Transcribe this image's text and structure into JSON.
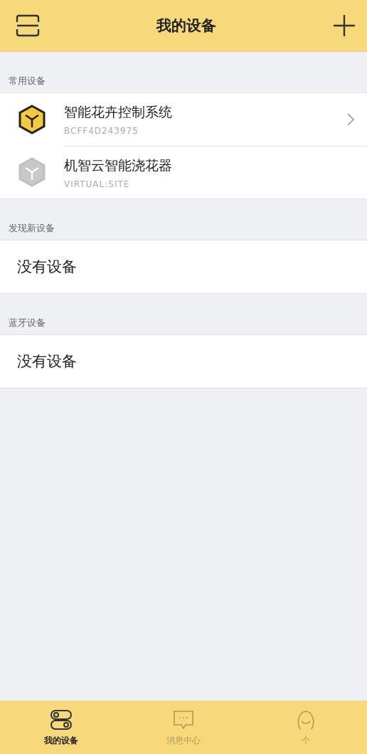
{
  "header": {
    "title": "我的设备"
  },
  "sections": [
    {
      "title": "常用设备",
      "devices": [
        {
          "name": "智能花卉控制系统",
          "id": "BCFF4D243975",
          "online": true,
          "chevron": true
        },
        {
          "name": "机智云智能浇花器",
          "id": "VIRTUAL:SITE",
          "online": false,
          "chevron": false
        }
      ]
    },
    {
      "title": "发现新设备",
      "empty_text": "没有设备"
    },
    {
      "title": "蓝牙设备",
      "empty_text": "没有设备"
    }
  ],
  "tabs": [
    {
      "kind": "devices",
      "label": "我的设备",
      "selected": true
    },
    {
      "kind": "messages",
      "label": "消息中心",
      "selected": false
    },
    {
      "kind": "person",
      "label": "个",
      "selected": false
    }
  ]
}
